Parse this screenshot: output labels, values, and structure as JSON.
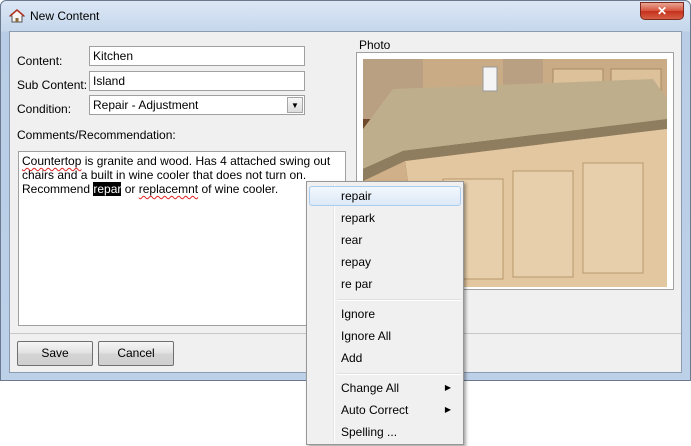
{
  "window": {
    "title": "New Content",
    "close_glyph": "✕"
  },
  "form": {
    "content_label": "Content:",
    "content_value": "Kitchen",
    "sub_content_label": "Sub Content:",
    "sub_content_value": "Island",
    "condition_label": "Condition:",
    "condition_value": "Repair - Adjustment",
    "comments_label": "Comments/Recommendation:",
    "comments": {
      "w1": "Countertop",
      "t1": " is granite and wood. Has 4 attached swing out chairs and a built in wine cooler that does not turn on. Recommend ",
      "w2": "repar",
      "t2": " or ",
      "w3": "replacemnt",
      "t3": " of wine cooler."
    }
  },
  "photo": {
    "label": "Photo"
  },
  "buttons": {
    "save": "Save",
    "cancel": "Cancel"
  },
  "context_menu": {
    "suggestions": [
      "repair",
      "repark",
      "rear",
      "repay",
      "re par"
    ],
    "ignore": "Ignore",
    "ignore_all": "Ignore All",
    "add": "Add",
    "change_all": "Change All",
    "auto_correct": "Auto Correct",
    "spelling": "Spelling ...",
    "submenu_glyph": "▶"
  },
  "icons": {
    "window": "home-icon",
    "close": "close-icon",
    "dropdown": "chevron-down-icon"
  }
}
